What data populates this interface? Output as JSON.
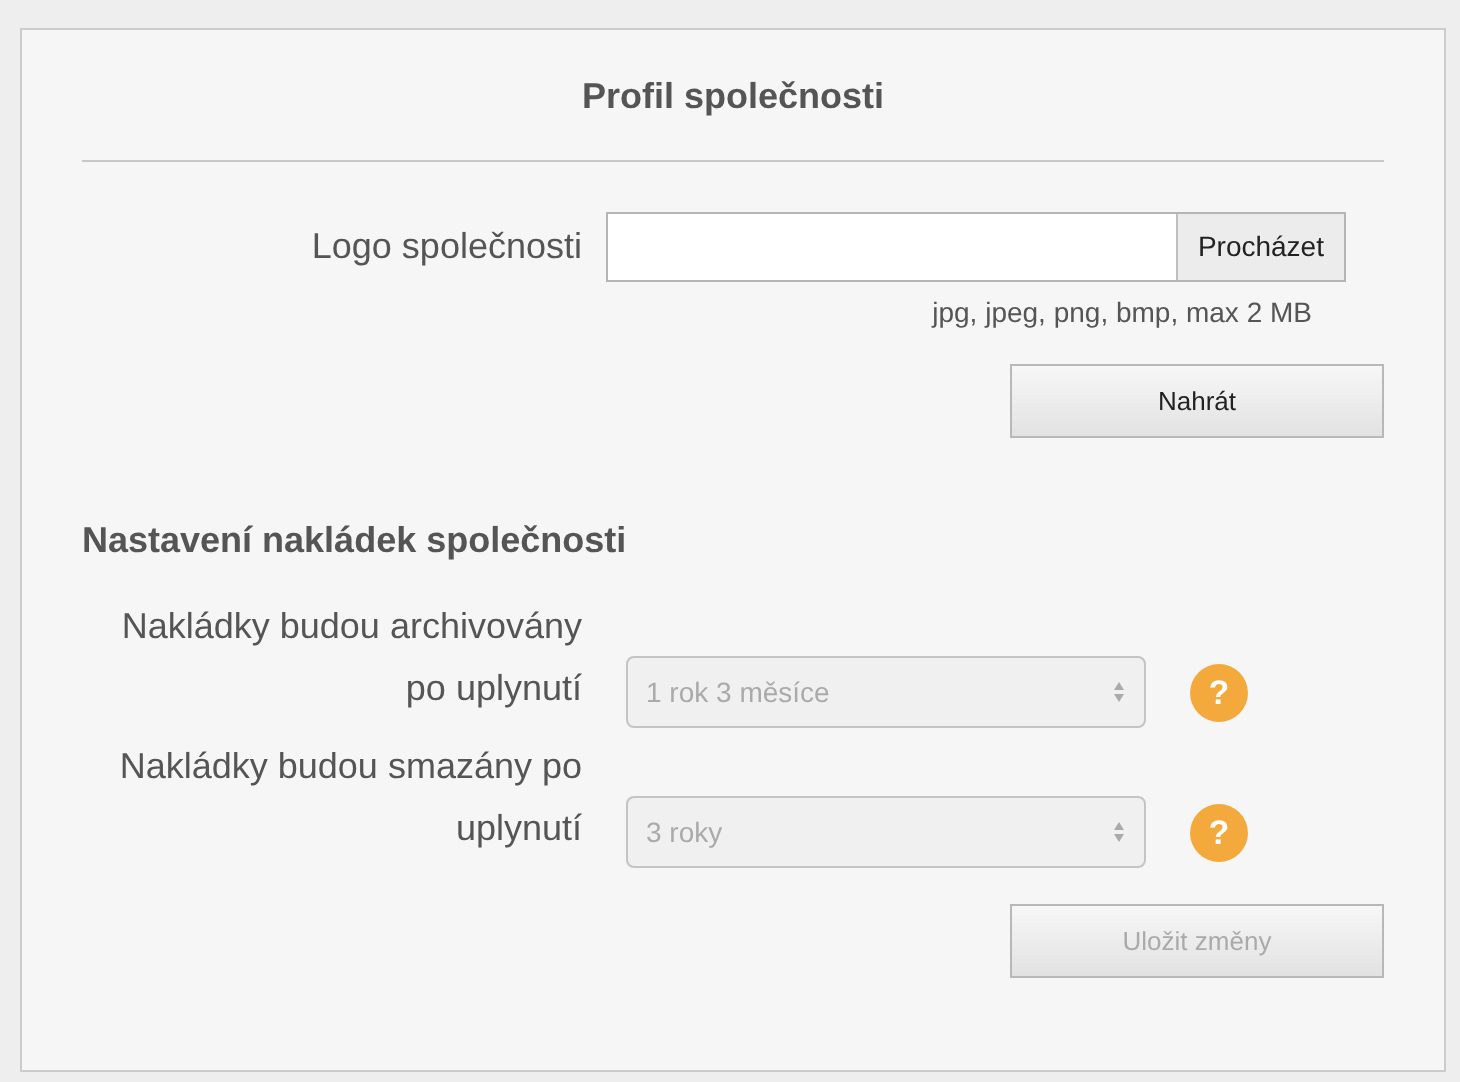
{
  "title": "Profil společnosti",
  "logo": {
    "label": "Logo společnosti",
    "browse_button": "Procházet",
    "hint": "jpg, jpeg, png, bmp, max 2 MB",
    "upload_button": "Nahrát"
  },
  "section_title": "Nastavení nakládek společnosti",
  "settings": [
    {
      "label": "Nakládky budou archivovány po uplynutí",
      "value": "1 rok 3 měsíce",
      "disabled": true,
      "help": "?"
    },
    {
      "label": "Nakládky budou smazány po uplynutí",
      "value": "3 roky",
      "disabled": true,
      "help": "?"
    }
  ],
  "save_button": {
    "label": "Uložit změny",
    "disabled": true
  }
}
